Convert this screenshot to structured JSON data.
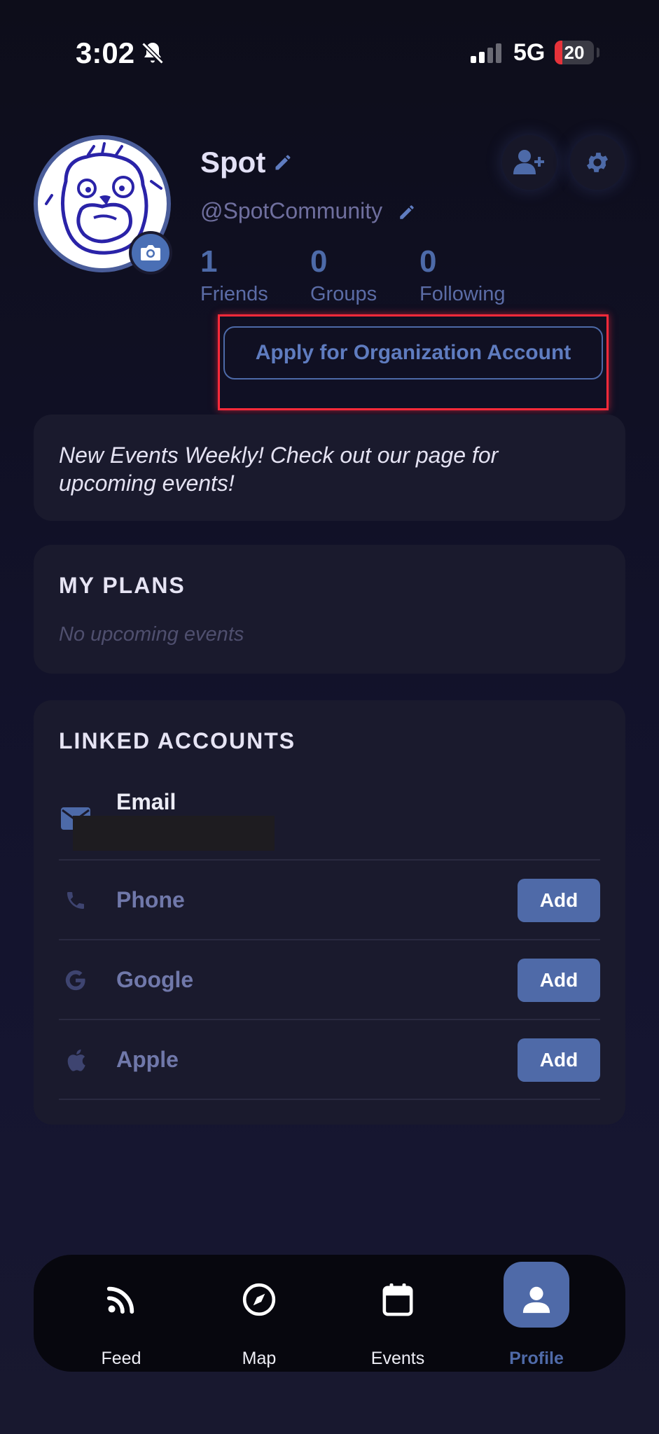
{
  "status_bar": {
    "time": "3:02",
    "network": "5G",
    "battery": "20",
    "battery_color": "#e6323a"
  },
  "profile": {
    "name": "Spot",
    "handle": "@SpotCommunity",
    "stats": [
      {
        "value": "1",
        "label": "Friends"
      },
      {
        "value": "0",
        "label": "Groups"
      },
      {
        "value": "0",
        "label": "Following"
      }
    ],
    "apply_button": "Apply for Organization Account",
    "accent_color": "#4f6aa8"
  },
  "announcement": {
    "text": "New Events Weekly! Check out our page for upcoming events!"
  },
  "plans": {
    "title": "MY PLANS",
    "empty": "No upcoming events"
  },
  "linked_accounts": {
    "title": "LINKED ACCOUNTS",
    "items": [
      {
        "label": "Email",
        "icon": "envelope-icon"
      },
      {
        "label": "Phone",
        "icon": "phone-icon",
        "action": "Add"
      },
      {
        "label": "Google",
        "icon": "google-icon",
        "action": "Add"
      },
      {
        "label": "Apple",
        "icon": "apple-icon",
        "action": "Add"
      }
    ]
  },
  "tabbar": {
    "tabs": [
      {
        "label": "Feed",
        "icon": "rss-icon"
      },
      {
        "label": "Map",
        "icon": "compass-icon"
      },
      {
        "label": "Events",
        "icon": "calendar-icon"
      },
      {
        "label": "Profile",
        "icon": "user-icon",
        "active": true
      }
    ]
  }
}
